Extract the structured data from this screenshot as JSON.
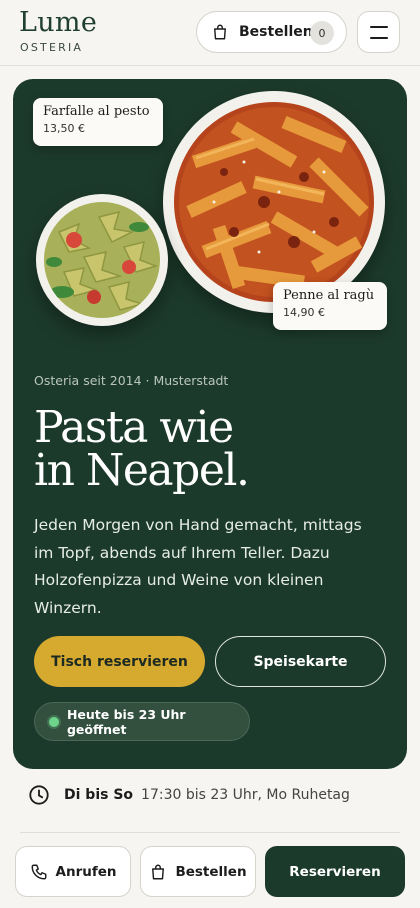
{
  "brand": {
    "name": "Lume",
    "subtitle": "OSTERIA"
  },
  "header": {
    "order_label": "Bestellen",
    "cart_count": "0",
    "menu_icon": "hamburger-icon",
    "bag_icon": "shopping-bag-icon"
  },
  "hero": {
    "dishes": [
      {
        "name": "Farfalle al pesto",
        "price": "13,50 €"
      },
      {
        "name": "Penne al ragù",
        "price": "14,90 €"
      }
    ],
    "since": "Osteria seit 2014 · Musterstadt",
    "headline_line1": "Pasta wie",
    "headline_line2": "in Neapel.",
    "intro": "Jeden Morgen von Hand gemacht, mittags im Topf, abends auf Ihrem Teller. Dazu Holzofenpizza und Weine von kleinen Winzern.",
    "cta_primary": "Tisch reservieren",
    "cta_secondary": "Speisekarte",
    "open_status": "Heute bis 23 Uhr geöffnet"
  },
  "hours": {
    "days": "Di bis So",
    "time": "17:30 bis 23 Uhr, Mo Ruhetag"
  },
  "bottom_bar": {
    "call": "Anrufen",
    "order": "Bestellen",
    "reserve": "Reservieren"
  },
  "colors": {
    "accent_green": "#1c3a2c",
    "accent_gold": "#d6a92f",
    "status_green": "#6dd48b"
  }
}
